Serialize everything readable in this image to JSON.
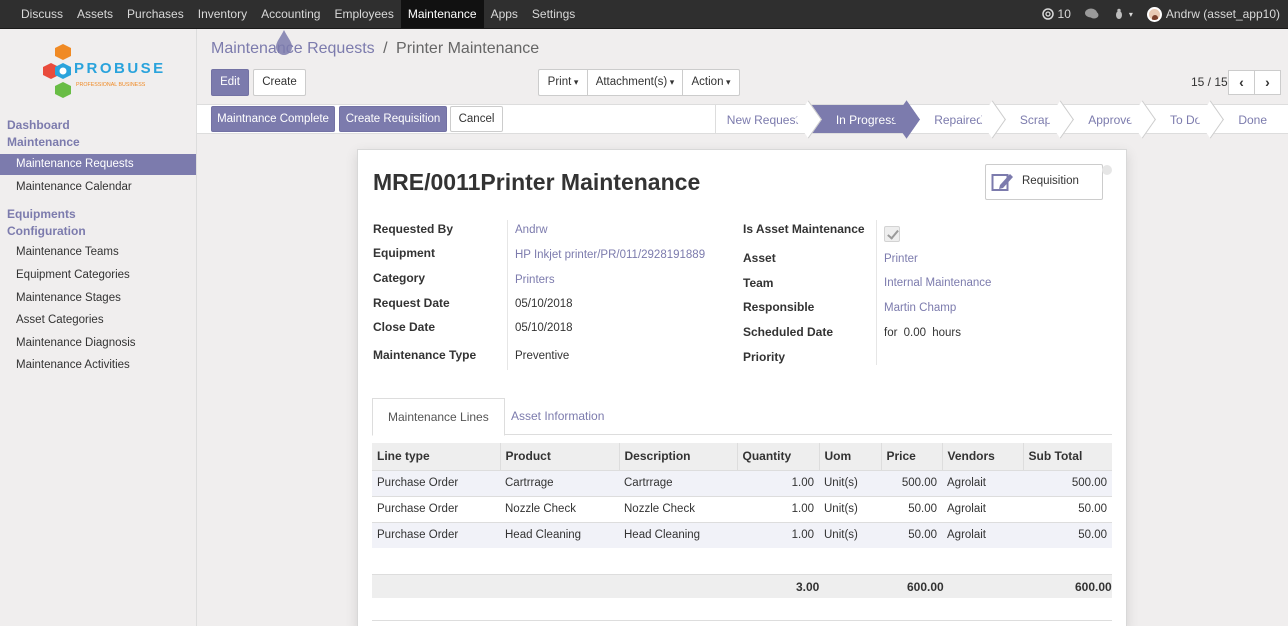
{
  "topnav": [
    "Discuss",
    "Assets",
    "Purchases",
    "Inventory",
    "Accounting",
    "Employees",
    "Maintenance",
    "Apps",
    "Settings"
  ],
  "topnav_active": "Maintenance",
  "topright": {
    "mentions_count": "10",
    "user": "Andrw (asset_app10)"
  },
  "logo": {
    "brand": "PROBUSE",
    "tagline": "PROFESSIONAL BUSINESS"
  },
  "sidebar": {
    "section1_line1": "Dashboard",
    "section1_line2": "Maintenance",
    "items1": [
      "Maintenance Requests",
      "Maintenance Calendar"
    ],
    "section2_line1": "Equipments",
    "section2_line2": "Configuration",
    "items2": [
      "Maintenance Teams",
      "Equipment Categories",
      "Maintenance Stages",
      "Asset Categories",
      "Maintenance Diagnosis",
      "Maintenance Activities"
    ]
  },
  "breadcrumb": {
    "parent": "Maintenance Requests",
    "sep": "/",
    "current": "Printer Maintenance"
  },
  "toolbar": {
    "edit": "Edit",
    "create": "Create",
    "print": "Print",
    "attachments": "Attachment(s)",
    "action": "Action"
  },
  "pager": {
    "label": "15 / 15",
    "prev": "‹",
    "next": "›"
  },
  "header_buttons": {
    "complete": "Maintnance Complete",
    "requisition": "Create Requisition",
    "cancel": "Cancel"
  },
  "stages": [
    "New Request",
    "In Progress",
    "Repaired",
    "Scrap",
    "Approve",
    "To Do",
    "Done"
  ],
  "active_stage": "In Progress",
  "record": {
    "title": "MRE/0011Printer Maintenance",
    "smart_button": "Requisition",
    "left_labels": {
      "requested_by": "Requested By",
      "equipment": "Equipment",
      "category": "Category",
      "request_date": "Request Date",
      "close_date": "Close Date",
      "maintenance_type": "Maintenance Type"
    },
    "left_values": {
      "requested_by": "Andrw",
      "equipment": "HP Inkjet printer/PR/011/2928191889",
      "category": "Printers",
      "request_date": "05/10/2018",
      "close_date": "05/10/2018",
      "maintenance_type": "Preventive"
    },
    "right_labels": {
      "is_asset": "Is Asset Maintenance",
      "asset": "Asset",
      "team": "Team",
      "responsible": "Responsible",
      "scheduled_date": "Scheduled Date",
      "priority": "Priority"
    },
    "right_values": {
      "asset": "Printer",
      "team": "Internal Maintenance",
      "responsible": "Martin Champ",
      "duration_prefix": "for",
      "duration": "0.00",
      "duration_unit": "hours"
    },
    "is_asset_checked": true
  },
  "tabs": [
    "Maintenance Lines",
    "Asset Information"
  ],
  "table": {
    "headers": [
      "Line type",
      "Product",
      "Description",
      "Quantity",
      "Uom",
      "Price",
      "Vendors",
      "Sub Total"
    ],
    "rows": [
      [
        "Purchase Order",
        "Cartrrage",
        "Cartrrage",
        "1.00",
        "Unit(s)",
        "500.00",
        "Agrolait",
        "500.00"
      ],
      [
        "Purchase Order",
        "Nozzle Check",
        "Nozzle Check",
        "1.00",
        "Unit(s)",
        "50.00",
        "Agrolait",
        "50.00"
      ],
      [
        "Purchase Order",
        "Head Cleaning",
        "Head Cleaning",
        "1.00",
        "Unit(s)",
        "50.00",
        "Agrolait",
        "50.00"
      ]
    ],
    "totals": {
      "quantity": "3.00",
      "price": "600.00",
      "subtotal": "600.00"
    }
  },
  "colors": {
    "accent": "#7c7bad",
    "topbar": "#2f2f2f"
  }
}
